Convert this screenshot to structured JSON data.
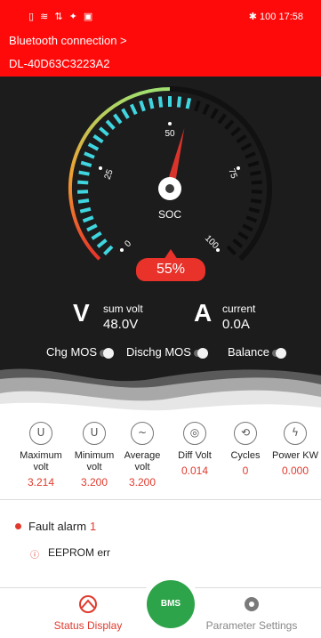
{
  "status_bar": {
    "left_icons": "sim wifi data bt app",
    "battery": "100",
    "time": "17:58"
  },
  "header": {
    "bluetooth_link": "Bluetooth connection >",
    "device_id": "DL-40D63C3223A2"
  },
  "gauge": {
    "center_label": "SOC",
    "ticks": [
      "0",
      "25",
      "50",
      "75",
      "100"
    ],
    "soc_value": "55%",
    "soc_fraction": 0.55
  },
  "meters": {
    "volt": {
      "label": "sum volt",
      "value": "48.0V",
      "symbol": "V"
    },
    "current": {
      "label": "current",
      "value": "0.0A",
      "symbol": "A"
    }
  },
  "toggles": {
    "chg": "Chg MOS",
    "dischg": "Dischg MOS",
    "balance": "Balance"
  },
  "stats": [
    {
      "name": "Maximum volt",
      "value": "3.214",
      "icon": "u-icon"
    },
    {
      "name": "Minimum volt",
      "value": "3.200",
      "icon": "u-icon"
    },
    {
      "name": "Average volt",
      "value": "3.200",
      "icon": "wave-icon"
    },
    {
      "name": "Diff Volt",
      "value": "0.014",
      "icon": "diff-icon"
    },
    {
      "name": "Cycles",
      "value": "0",
      "icon": "cycle-icon"
    },
    {
      "name": "Power KW",
      "value": "0.000",
      "icon": "power-icon"
    }
  ],
  "fault": {
    "title": "Fault alarm",
    "count": "1",
    "items": [
      "EEPROM err"
    ]
  },
  "nav": {
    "status": "Status Display",
    "center": "BMS",
    "params": "Parameter Settings"
  },
  "colors": {
    "header_red": "#ff0a0a",
    "accent_red": "#e03a2d",
    "dark_bg": "#1c1c1c",
    "nav_green": "#2ea44a"
  }
}
